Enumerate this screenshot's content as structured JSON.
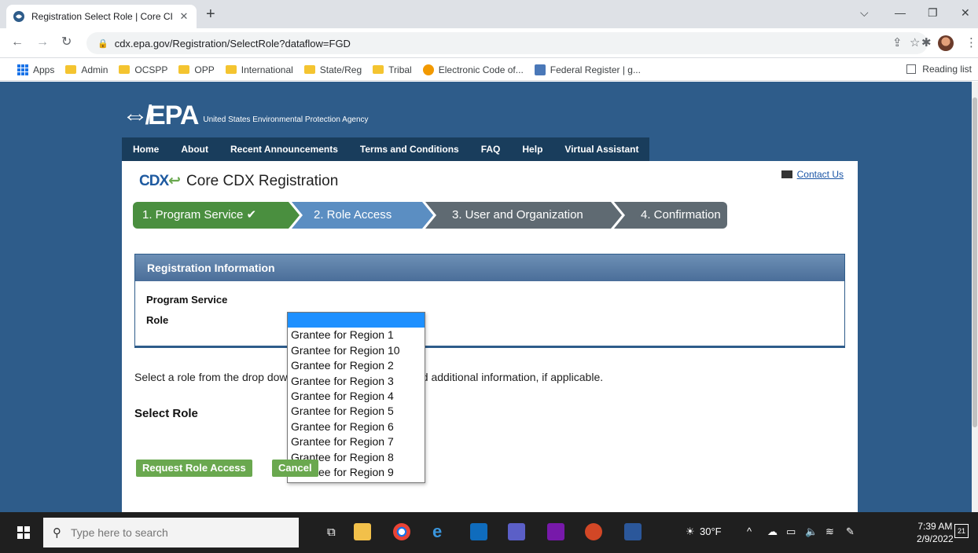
{
  "browser": {
    "tab_title": "Registration Select Role | Core CI",
    "tab_close": "✕",
    "new_tab": "+",
    "url": "cdx.epa.gov/Registration/SelectRole?dataflow=FGD",
    "bookmarks": [
      "Apps",
      "Admin",
      "OCSPP",
      "OPP",
      "International",
      "State/Reg",
      "Tribal",
      "Electronic Code of...",
      "Federal Register | g..."
    ],
    "reading_list": "Reading list"
  },
  "site": {
    "logo_mark": "⇎EPA",
    "logo_sub": "United States Environmental Protection Agency",
    "nav": [
      "Home",
      "About",
      "Recent Announcements",
      "Terms and Conditions",
      "FAQ",
      "Help",
      "Virtual Assistant"
    ]
  },
  "page": {
    "cdx_logo": "CDX",
    "title": "Core CDX Registration",
    "contact": "Contact Us",
    "steps": [
      "1. Program Service ✔",
      "2. Role Access",
      "3. User and Organization",
      "4. Confirmation"
    ],
    "reg_header": "Registration Information",
    "reg_rows": [
      "Program Service",
      "Role"
    ],
    "instruction": "Select a role from the drop down menu and provide required additional information, if applicable.",
    "select_label": "Select Role",
    "dropdown_options": [
      "",
      "Grantee for Region 1",
      "Grantee for Region 10",
      "Grantee for Region 2",
      "Grantee for Region 3",
      "Grantee for Region 4",
      "Grantee for Region 5",
      "Grantee for Region 6",
      "Grantee for Region 7",
      "Grantee for Region 8",
      "Grantee for Region 9"
    ],
    "request_button": "Request Role Access",
    "cancel_button": "Cancel"
  },
  "taskbar": {
    "search_placeholder": "Type here to search",
    "weather": "30°F",
    "time": "7:39 AM",
    "date": "2/9/2022",
    "notifications": "21"
  },
  "colors": {
    "page_bg": "#2e5c8a",
    "nav_bg": "#193d5c",
    "step_done": "#4a8f3f",
    "step_active": "#5b8ec2",
    "step_todo": "#5f6a72",
    "button": "#6aa84f",
    "dropdown_highlight": "#1e90ff"
  }
}
